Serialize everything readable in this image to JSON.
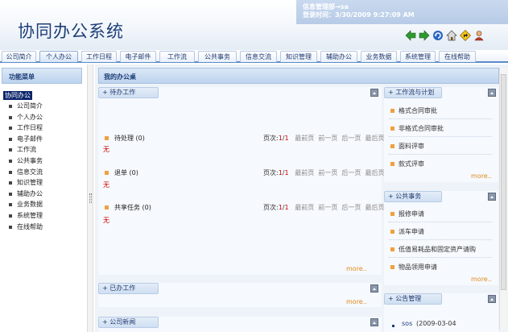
{
  "header": {
    "app_title": "协同办公系统",
    "user_line": "信息管理部→sa",
    "login_line": "登录时间：3/30/2009 9:27:09 AM"
  },
  "toolbar_icons": [
    "back-arrow-icon",
    "forward-arrow-icon",
    "refresh-icon",
    "home-icon",
    "directions-icon",
    "user-icon"
  ],
  "colors": {
    "accent": "#1e3e78",
    "tab_border": "#5b8ac9",
    "more": "#e08a1c",
    "alert": "#cc0000"
  },
  "tabs": [
    {
      "label": "公司简介"
    },
    {
      "label": "个人办公"
    },
    {
      "label": "工作日程"
    },
    {
      "label": "电子邮件"
    },
    {
      "label": "工作流"
    },
    {
      "label": "公共事务"
    },
    {
      "label": "信息交流"
    },
    {
      "label": "知识管理"
    },
    {
      "label": "辅助办公"
    },
    {
      "label": "业务数据"
    },
    {
      "label": "系统管理"
    },
    {
      "label": "在线帮助"
    }
  ],
  "sidebar": {
    "title": "功能菜单",
    "root": "协同办公",
    "items": [
      "公司简介",
      "个人办公",
      "工作日程",
      "电子邮件",
      "工作流",
      "公共事务",
      "信息交流",
      "知识管理",
      "辅助办公",
      "业务数据",
      "系统管理",
      "在线帮助"
    ]
  },
  "main": {
    "title": "我的办公桌",
    "todo": {
      "header": "+ 待办工作",
      "sections": [
        {
          "label": "待处理 (0)",
          "page_label": "页次:",
          "page_current": "1",
          "page_sep": "/",
          "page_total": "1",
          "first": "最前页",
          "prev": "前一页",
          "next": "后一页",
          "last": "最后页",
          "empty": "无"
        },
        {
          "label": "退单 (0)",
          "page_label": "页次:",
          "page_current": "1",
          "page_sep": "/",
          "page_total": "1",
          "first": "最前页",
          "prev": "前一页",
          "next": "后一页",
          "last": "最后页",
          "empty": "无"
        },
        {
          "label": "共享任务 (0)",
          "page_label": "页次:",
          "page_current": "1",
          "page_sep": "/",
          "page_total": "1",
          "first": "最前页",
          "prev": "前一页",
          "next": "后一页",
          "last": "最后页",
          "empty": "无"
        }
      ],
      "more": "more.."
    },
    "done": {
      "header": "+ 已办工作",
      "more": "more.."
    },
    "news": {
      "header": "+ 公司新闻"
    },
    "workflow": {
      "header": "+ 工作流与计划",
      "items": [
        "格式合同审批",
        "非格式合同审批",
        "面料评审",
        "款式评审"
      ],
      "more": "more.."
    },
    "public": {
      "header": "+ 公共事务",
      "items": [
        "报修申请",
        "派车申请",
        "低值易耗品和固定资产请购",
        "物品领用申请"
      ],
      "more": "more.."
    },
    "notice": {
      "header": "+ 公告管理",
      "items": [
        {
          "title": "sos",
          "date": "(2009-03-04"
        }
      ]
    }
  }
}
